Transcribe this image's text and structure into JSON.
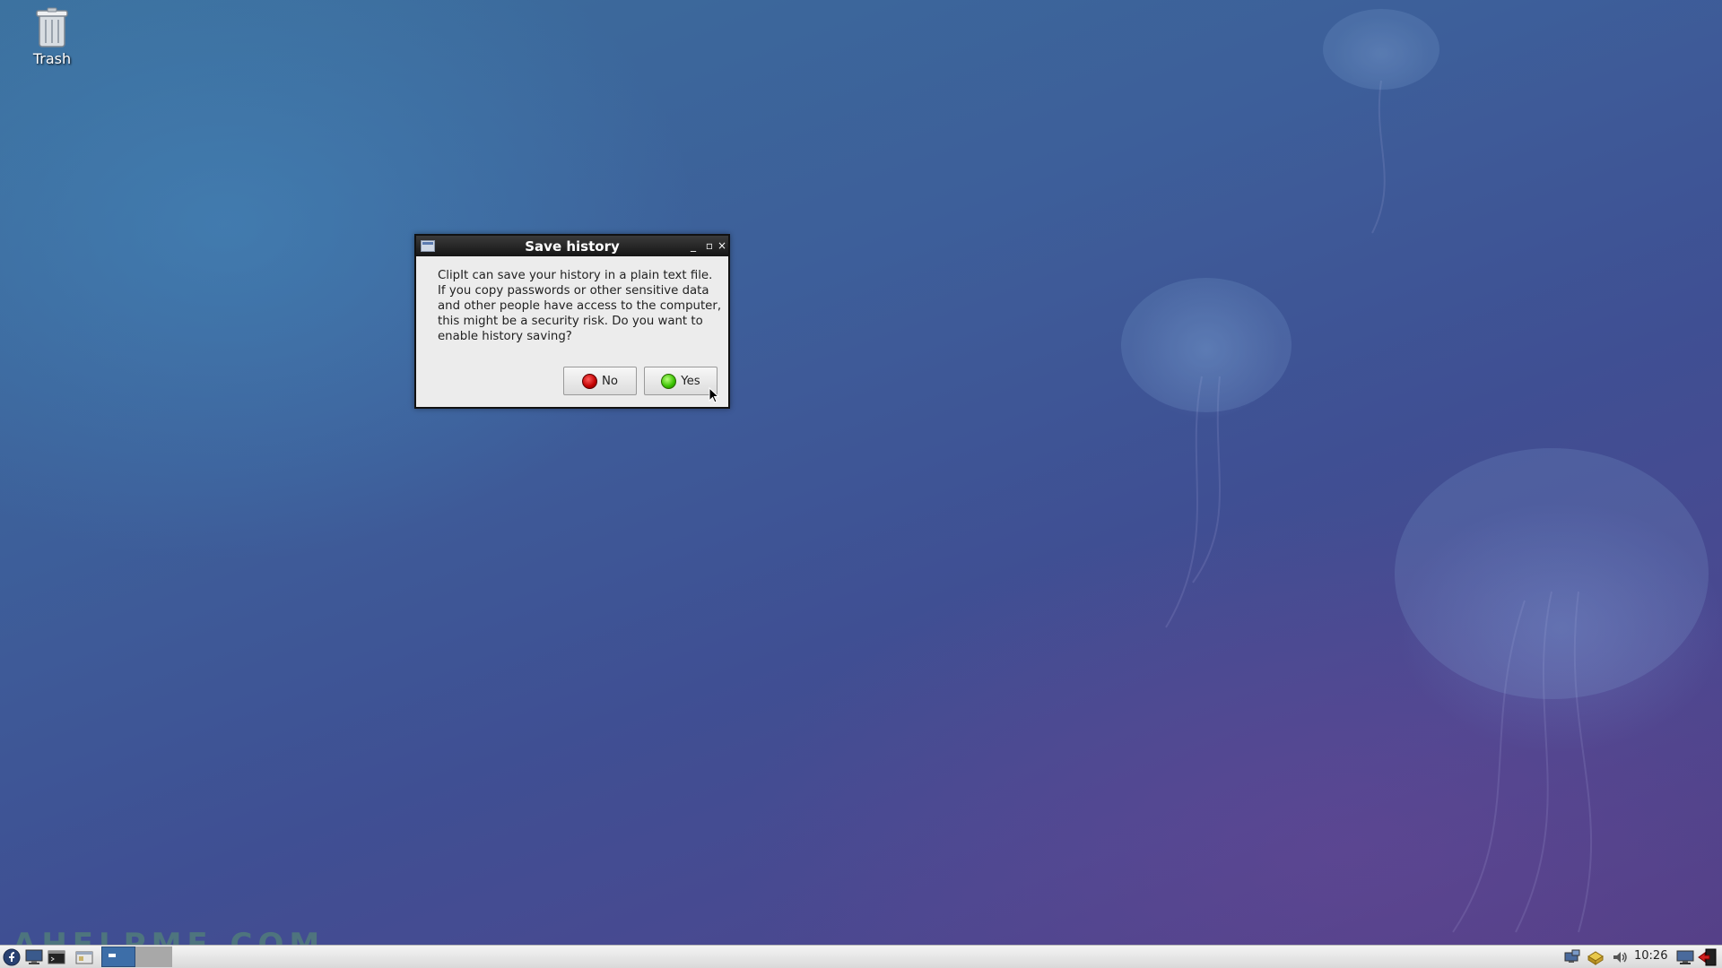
{
  "desktop": {
    "trash_label": "Trash",
    "watermark": "AHELPME.COM"
  },
  "dialog": {
    "title": "Save history",
    "message": "ClipIt can save your history in a plain text file. If you copy passwords or other sensitive data and other people have access to the computer, this might be a security risk. Do you want to enable history saving?",
    "no_label": "No",
    "yes_label": "Yes",
    "minimize_glyph": "_",
    "maximize_glyph": "▫",
    "close_glyph": "×"
  },
  "taskbar": {
    "clock": "10:26",
    "launchers": [
      "fedora-menu-icon",
      "desktop-icon",
      "terminal-icon",
      "file-manager-icon"
    ],
    "tray": [
      "network-icon",
      "clipboard-icon",
      "volume-icon",
      "monitor-icon",
      "logout-icon"
    ]
  },
  "colors": {
    "no_button": "#c00000",
    "yes_button": "#38c000",
    "titlebar": "#1e1e1e"
  }
}
